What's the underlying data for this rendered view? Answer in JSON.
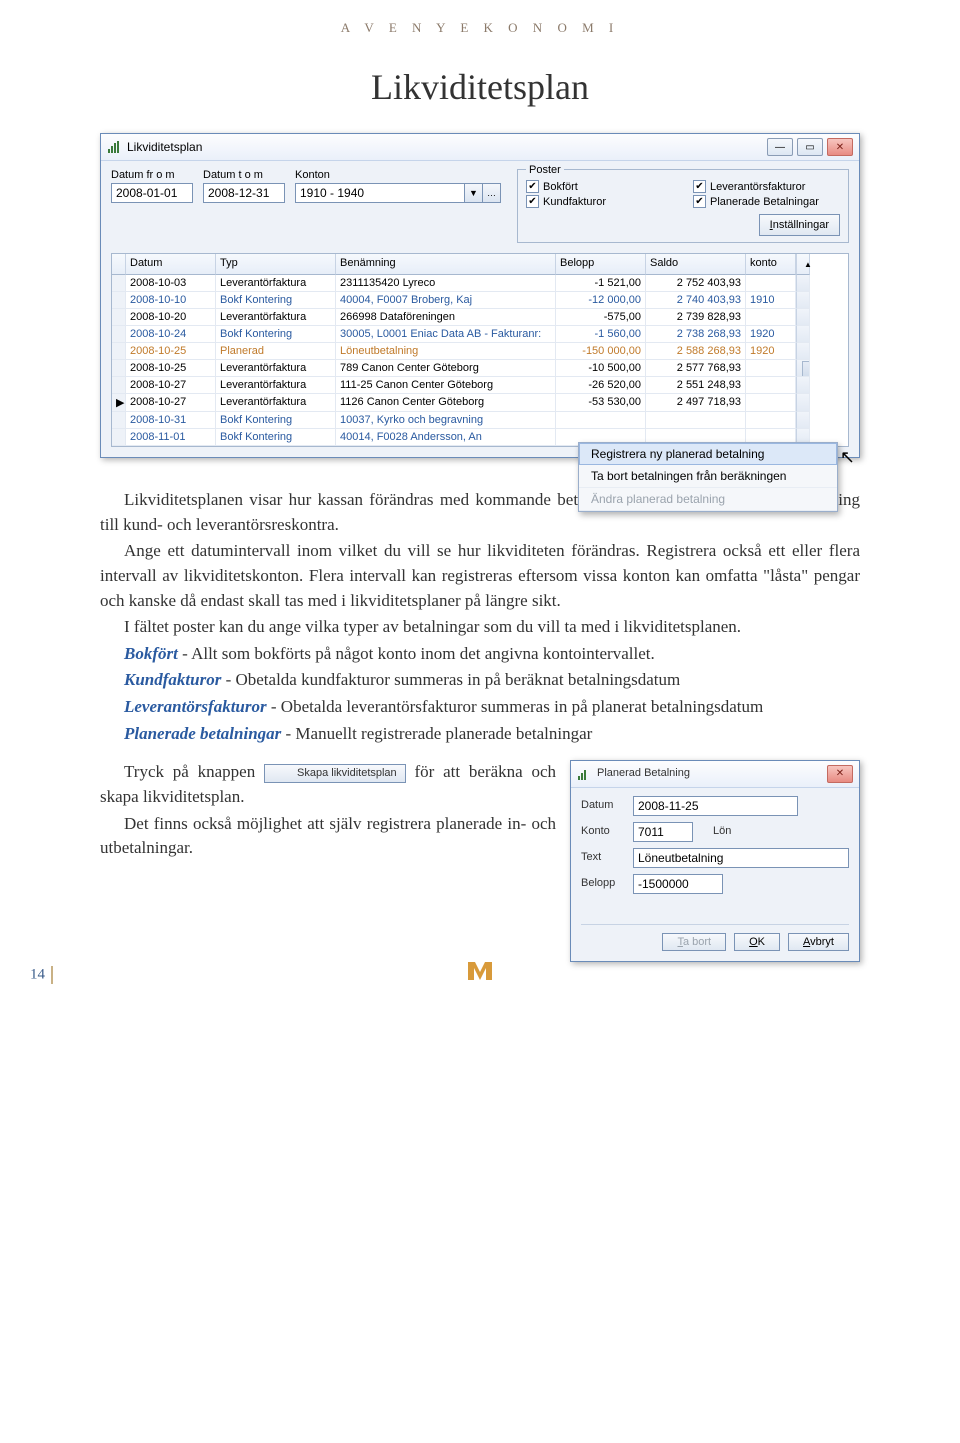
{
  "brand": "A V E N Y   E K O N O M I",
  "title": "Likviditetsplan",
  "window": {
    "title": "Likviditetsplan",
    "date_from_label": "Datum fr o m",
    "date_from": "2008-01-01",
    "date_to_label": "Datum t o m",
    "date_to": "2008-12-31",
    "konton_label": "Konton",
    "konton": "1910 - 1940",
    "poster_legend": "Poster",
    "check_bokfort": "Bokfört",
    "check_kundfakturor": "Kundfakturor",
    "check_leverantor": "Leverantörsfakturor",
    "check_planerade": "Planerade Betalningar",
    "settings_btn": "Inställningar",
    "headers": {
      "datum": "Datum",
      "typ": "Typ",
      "benamning": "Benämning",
      "belopp": "Belopp",
      "saldo": "Saldo",
      "konto": "konto"
    },
    "rows": [
      {
        "datum": "2008-10-03",
        "typ": "Leverantörfaktura",
        "ben": "2311135420 Lyreco",
        "belopp": "-1 521,00",
        "saldo": "2 752 403,93",
        "konto": ""
      },
      {
        "datum": "2008-10-10",
        "typ": "Bokf Kontering",
        "ben": "40004, F0007 Broberg, Kaj",
        "belopp": "-12 000,00",
        "saldo": "2 740 403,93",
        "konto": "1910",
        "cls": "blue"
      },
      {
        "datum": "2008-10-20",
        "typ": "Leverantörfaktura",
        "ben": "266998 Dataföreningen",
        "belopp": "-575,00",
        "saldo": "2 739 828,93",
        "konto": ""
      },
      {
        "datum": "2008-10-24",
        "typ": "Bokf Kontering",
        "ben": "30005, L0001 Eniac Data AB - Fakturanr:",
        "belopp": "-1 560,00",
        "saldo": "2 738 268,93",
        "konto": "1920",
        "cls": "blue"
      },
      {
        "datum": "2008-10-25",
        "typ": "Planerad",
        "ben": "Löneutbetalning",
        "belopp": "-150 000,00",
        "saldo": "2 588 268,93",
        "konto": "1920",
        "cls": "orange"
      },
      {
        "datum": "2008-10-25",
        "typ": "Leverantörfaktura",
        "ben": "789 Canon Center Göteborg",
        "belopp": "-10 500,00",
        "saldo": "2 577 768,93",
        "konto": ""
      },
      {
        "datum": "2008-10-27",
        "typ": "Leverantörfaktura",
        "ben": "111-25 Canon Center Göteborg",
        "belopp": "-26 520,00",
        "saldo": "2 551 248,93",
        "konto": ""
      },
      {
        "datum": "2008-10-27",
        "typ": "Leverantörfaktura",
        "ben": "1126 Canon Center Göteborg",
        "belopp": "-53 530,00",
        "saldo": "2 497 718,93",
        "konto": "",
        "mark": "▶"
      },
      {
        "datum": "2008-10-31",
        "typ": "Bokf Kontering",
        "ben": "10037, Kyrko och begravning",
        "belopp": "",
        "saldo": "",
        "konto": "",
        "cls": "blue"
      },
      {
        "datum": "2008-11-01",
        "typ": "Bokf Kontering",
        "ben": "40014, F0028 Andersson, An",
        "belopp": "",
        "saldo": "",
        "konto": "",
        "cls": "blue"
      }
    ],
    "context_menu": {
      "item1": "Registrera ny planerad betalning",
      "item2": "Ta bort betalningen från beräkningen",
      "item3": "Ändra planerad betalning"
    }
  },
  "body": {
    "p1": "Likviditetsplanen visar hur kassan förändras med kommande betalningar. Innehåller automatisk knytning till kund- och leverantörsreskontra.",
    "p2": "Ange ett datumintervall inom vilket du vill se hur likviditeten förändras. Registrera också ett eller flera intervall av likviditetskonton. Flera intervall kan registreras eftersom vissa konton kan omfatta \"låsta\" pengar och kanske då endast skall tas med i likviditetsplaner på längre sikt.",
    "p3": "I fältet poster kan du ange vilka typer av betalningar som du vill ta med i likviditetsplanen.",
    "b_bokfort": "Bokfört",
    "p_bokfort": " - Allt som bokförts på något konto inom det angivna kontointervallet.",
    "b_kund": "Kundfakturor",
    "p_kund": " - Obetalda kundfakturor summeras in på beräknat betalningsdatum",
    "b_lev": "Leverantörsfakturor",
    "p_lev": " - Obetalda leverantörsfakturor summeras in på planerat betalningsdatum",
    "b_plan": "Planerade betalningar",
    "p_plan": " - Manuellt registrerade planerade betalningar",
    "p4a": "Tryck på knappen ",
    "inline_btn": "Skapa likviditetsplan",
    "p4b": " för att beräkna och skapa likviditetsplan.",
    "p5": "Det finns också möjlighet att själv registrera planerade in- och utbetalningar."
  },
  "dialog2": {
    "title": "Planerad Betalning",
    "datum_l": "Datum",
    "datum_v": "2008-11-25",
    "konto_l": "Konto",
    "konto_v": "7011",
    "konto_name": "Lön",
    "text_l": "Text",
    "text_v": "Löneutbetalning",
    "belopp_l": "Belopp",
    "belopp_v": "-1500000",
    "btn_tabort": "Ta bort",
    "btn_ok": "OK",
    "btn_avbryt": "Avbryt"
  },
  "page_number": "14"
}
